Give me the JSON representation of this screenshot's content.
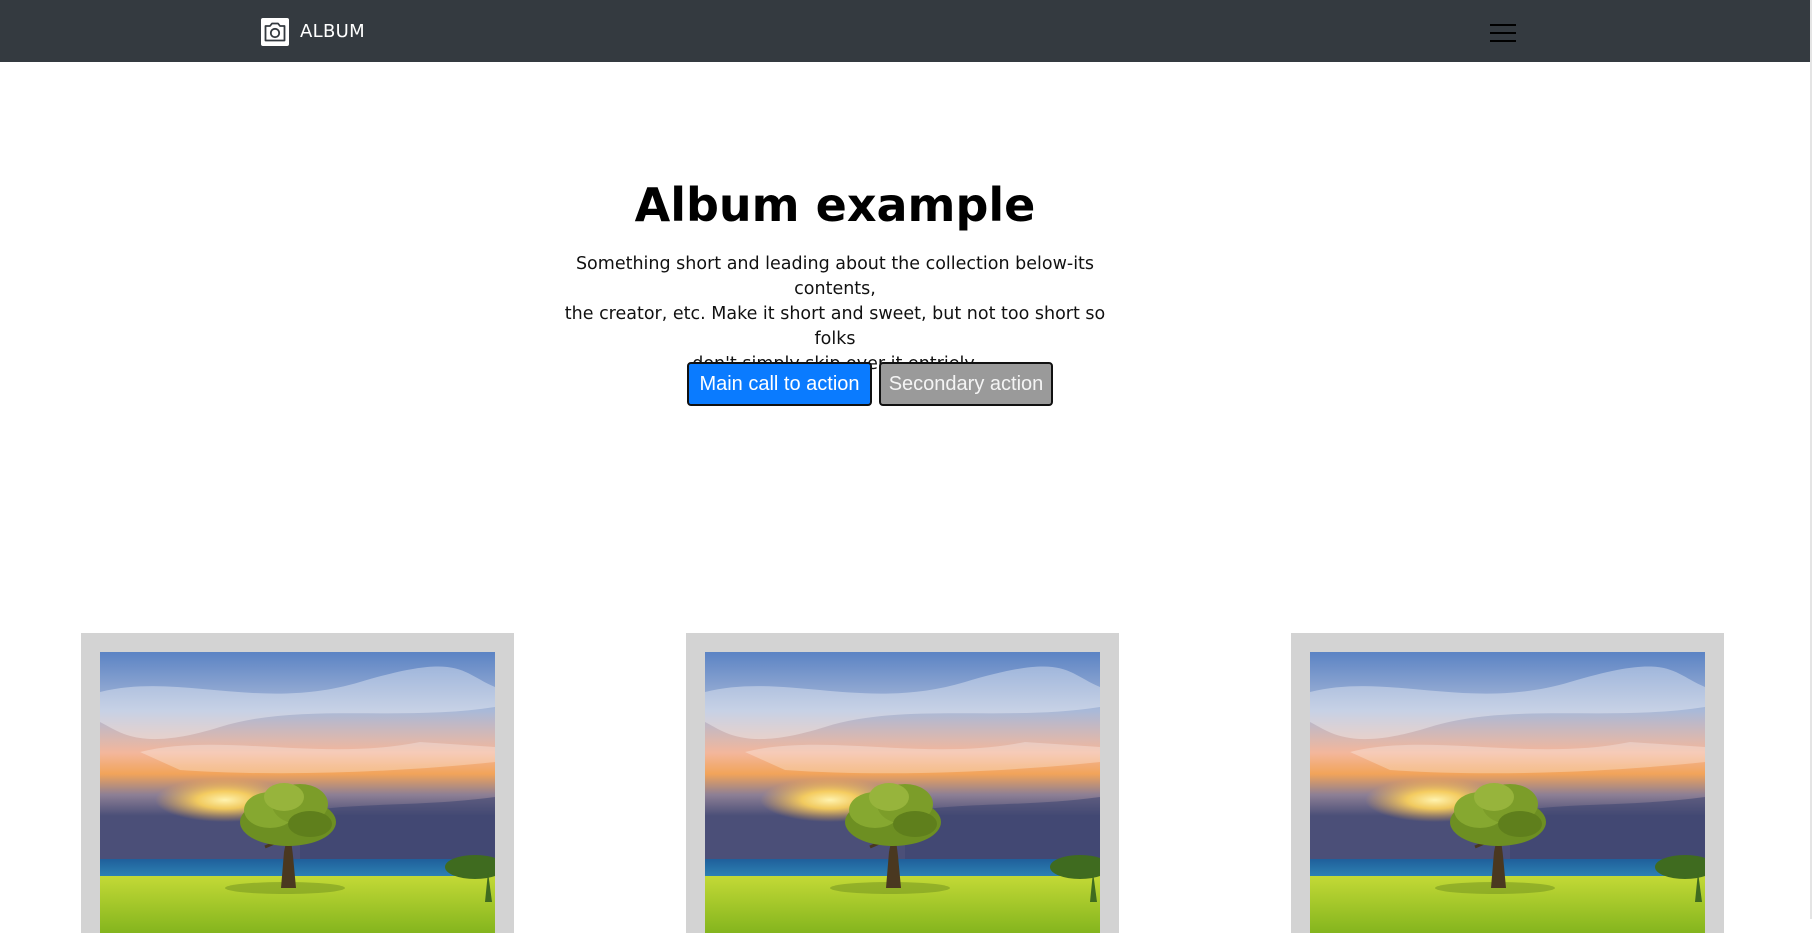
{
  "navbar": {
    "brand_text": "ALBUM",
    "brand_icon": "camera-icon",
    "menu_icon": "hamburger-menu-icon",
    "background": "#343a40"
  },
  "hero": {
    "title": "Album example",
    "lead_lines": [
      "Something short and leading about the collection below-its contents,",
      "the creator, etc. Make it short and sweet, but not too short so folks",
      "don't simply skip over it entriely."
    ],
    "primary_button": "Main call to action",
    "secondary_button": "Secondary action",
    "primary_color": "#0a7bff",
    "secondary_color": "#9a9a9a"
  },
  "album": {
    "cards": [
      {
        "image": "tree-sunset-photo"
      },
      {
        "image": "tree-sunset-photo"
      },
      {
        "image": "tree-sunset-photo"
      }
    ]
  }
}
